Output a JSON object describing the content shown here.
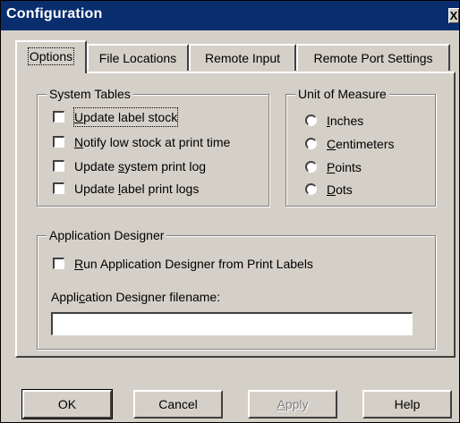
{
  "window": {
    "title": "Configuration",
    "close_glyph": "X"
  },
  "tabs": [
    {
      "label": "Options",
      "active": true
    },
    {
      "label": "File Locations",
      "active": false
    },
    {
      "label": "Remote Input",
      "active": false
    },
    {
      "label": "Remote Port Settings",
      "active": false
    }
  ],
  "system_tables": {
    "legend": "System Tables",
    "items": [
      {
        "pre": "",
        "key": "U",
        "post": "pdate label stock",
        "checked": false
      },
      {
        "pre": "",
        "key": "N",
        "post": "otify low stock at print time",
        "checked": false
      },
      {
        "pre": "Update ",
        "key": "s",
        "post": "ystem print log",
        "checked": false
      },
      {
        "pre": "Update ",
        "key": "l",
        "post": "abel print logs",
        "checked": false
      }
    ]
  },
  "unit_of_measure": {
    "legend": "Unit of Measure",
    "options": [
      {
        "pre": "",
        "key": "I",
        "post": "nches",
        "selected": false
      },
      {
        "pre": "",
        "key": "C",
        "post": "entimeters",
        "selected": false
      },
      {
        "pre": "",
        "key": "P",
        "post": "oints",
        "selected": false
      },
      {
        "pre": "",
        "key": "D",
        "post": "ots",
        "selected": false
      }
    ]
  },
  "application_designer": {
    "legend": "Application Designer",
    "run_checkbox": {
      "pre": "",
      "key": "R",
      "post": "un Application Designer from Print Labels",
      "checked": false
    },
    "filename_label": {
      "pre": "Appli",
      "key": "c",
      "post": "ation Designer filename:"
    },
    "filename_value": ""
  },
  "buttons": {
    "ok": "OK",
    "cancel": "Cancel",
    "apply_key": "A",
    "apply_rest": "pply",
    "help": "Help"
  },
  "colors": {
    "titlebar": "#0a2d6e",
    "face": "#d4d0c8",
    "disabled_text": "#808080"
  }
}
